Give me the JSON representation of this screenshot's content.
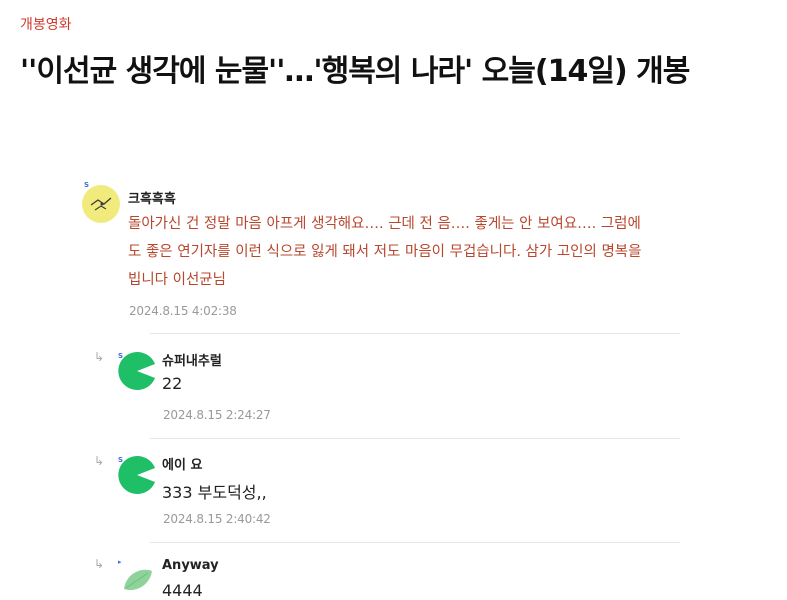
{
  "article": {
    "category": "개봉영화",
    "headline": "''이선균 생각에 눈물''…'행복의 나라' 오늘(14일) 개봉"
  },
  "comments": [
    {
      "nickname": "크흑흑흑",
      "text": "돌아가신 건 정말 마음 아프게 생각해요…. 근데 전 음…. 좋게는 안 보여요…. 그럼에\n도 좋은 연기자를 이런 식으로 잃게 돼서 저도 마음이 무겁습니다. 삼가 고인의 명복을\n빕니다 이선균님",
      "date": "2024.8.15 4:02:38"
    }
  ],
  "replies": [
    {
      "nickname": "슈퍼내추럴",
      "text": "22",
      "date": "2024.8.15 2:24:27"
    },
    {
      "nickname": "에이 요",
      "text": "333 부도덕성,,",
      "date": "2024.8.15 2:40:42"
    },
    {
      "nickname": "Anyway",
      "text": "4444"
    }
  ],
  "badges": {
    "main": "S",
    "reply1": "S",
    "reply2": "S",
    "reply3": "▸"
  },
  "icons": {
    "reply_arrow": "↳"
  },
  "colors": {
    "category": "#d0392b",
    "comment_text": "#b8472e",
    "avatar_green": "#1fbf68",
    "avatar_yellow": "#f1eb7e",
    "leaf_green": "#8fd39a"
  }
}
